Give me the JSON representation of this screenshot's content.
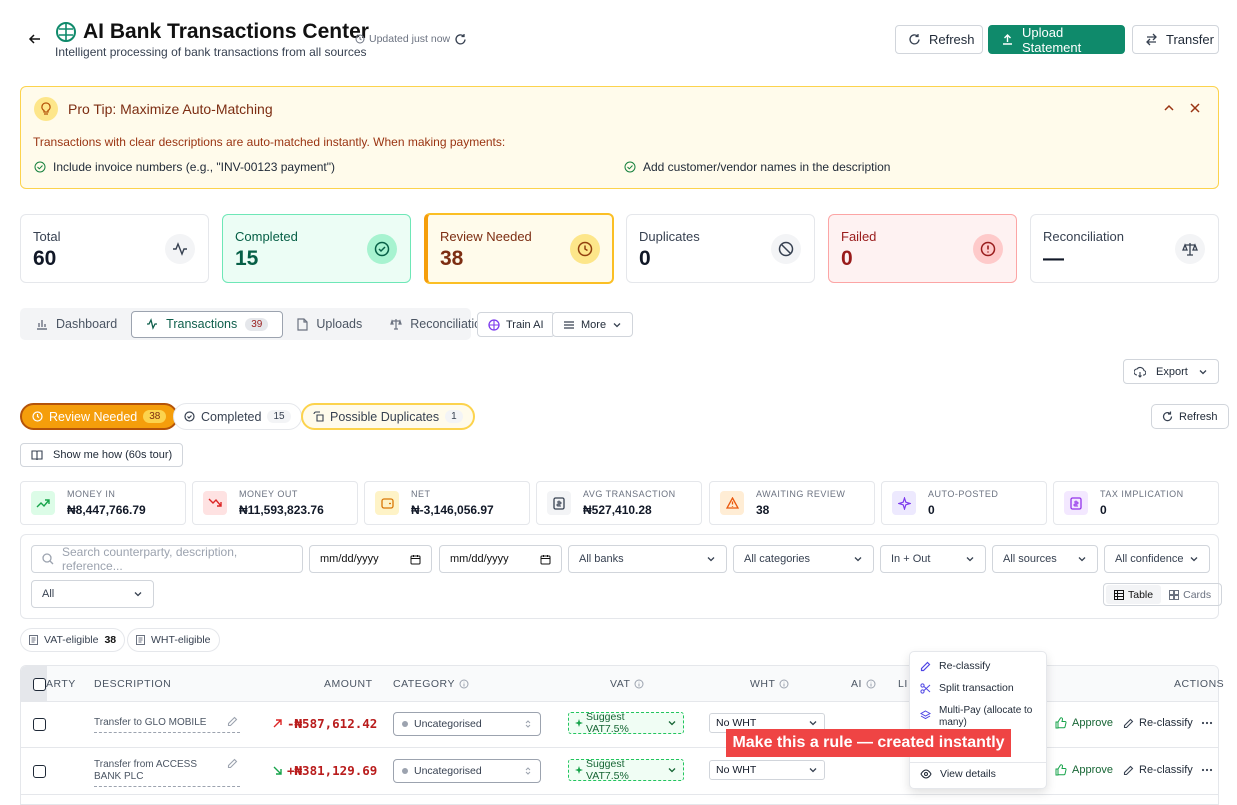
{
  "header": {
    "title": "AI Bank Transactions Center",
    "subtitle": "Intelligent processing of bank transactions from all sources",
    "updated": "Updated just now",
    "refresh_label": "Refresh",
    "upload_label": "Upload Statement",
    "transfer_label": "Transfer"
  },
  "tip": {
    "title": "Pro Tip: Maximize Auto-Matching",
    "body": "Transactions with clear descriptions are auto-matched instantly. When making payments:",
    "item1": "Include invoice numbers (e.g., \"INV-00123 payment\")",
    "item2": "Add customer/vendor names in the description"
  },
  "stats": [
    {
      "label": "Total",
      "value": "60"
    },
    {
      "label": "Completed",
      "value": "15"
    },
    {
      "label": "Review Needed",
      "value": "38"
    },
    {
      "label": "Duplicates",
      "value": "0"
    },
    {
      "label": "Failed",
      "value": "0"
    },
    {
      "label": "Reconciliation",
      "value": "—"
    }
  ],
  "tabs": {
    "dashboard": "Dashboard",
    "transactions": "Transactions",
    "transactions_count": "39",
    "uploads": "Uploads",
    "reconciliation": "Reconciliation",
    "train": "Train AI",
    "more": "More"
  },
  "export_label": "Export",
  "filters": {
    "review": "Review Needed",
    "review_count": "38",
    "completed": "Completed",
    "completed_count": "15",
    "duplicates": "Possible Duplicates",
    "duplicates_count": "1",
    "refresh": "Refresh",
    "tour": "Show me how (60s tour)"
  },
  "metrics": [
    {
      "label": "Money In",
      "value": "₦8,447,766.79"
    },
    {
      "label": "Money Out",
      "value": "₦11,593,823.76"
    },
    {
      "label": "Net",
      "value": "₦-3,146,056.97"
    },
    {
      "label": "Avg Transaction",
      "value": "₦527,410.28"
    },
    {
      "label": "Awaiting Review",
      "value": "38"
    },
    {
      "label": "Auto-Posted",
      "value": "0"
    },
    {
      "label": "Tax Implication",
      "value": "0"
    }
  ],
  "search": {
    "placeholder": "Search counterparty, description, reference...",
    "date_placeholder": "mm/dd/yyyy",
    "banks": "All banks",
    "categories": "All categories",
    "direction": "In + Out",
    "sources": "All sources",
    "confidence": "All confidence",
    "all": "All",
    "table": "Table",
    "cards": "Cards"
  },
  "tags": {
    "vat": "VAT-eligible",
    "vat_count": "38",
    "wht": "WHT-eligible"
  },
  "table": {
    "headers": {
      "party": "ARTY",
      "description": "DESCRIPTION",
      "amount": "AMOUNT",
      "category": "CATEGORY",
      "vat": "VAT",
      "wht": "WHT",
      "ai": "AI",
      "li": "LI",
      "actions": "ACTIONS"
    },
    "rows": [
      {
        "description": "Transfer to GLO MOBILE",
        "amount": "-₦587,612.42",
        "category": "Uncategorised",
        "vat": "Suggest VAT7.5%",
        "wht": "No WHT",
        "approve": "Approve",
        "reclassify": "Re-classify"
      },
      {
        "description": "Transfer from ACCESS BANK PLC",
        "amount": "+₦381,129.69",
        "category": "Uncategorised",
        "vat": "Suggest VAT7.5%",
        "wht": "No WHT",
        "approve": "Approve",
        "reclassify": "Re-classify"
      }
    ]
  },
  "menu": {
    "reclassify": "Re-classify",
    "split": "Split transaction",
    "multipay": "Multi-Pay (allocate to many)",
    "view": "View details"
  },
  "toast": "Make this a rule — created instantly"
}
